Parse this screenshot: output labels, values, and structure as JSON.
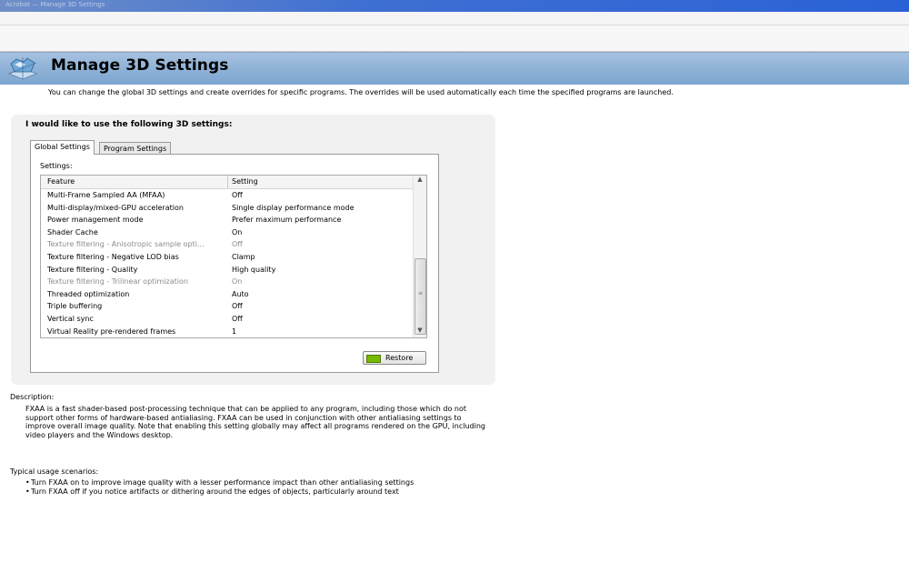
{
  "window": {
    "title_bar_text": "Acrobat — Manage 3D Settings"
  },
  "header": {
    "title": "Manage 3D Settings",
    "icon": "nvidia-3d-settings-icon"
  },
  "intro_text": "You can change the global 3D settings and create overrides for specific programs. The overrides will be used automatically each time the specified programs are launched.",
  "panel": {
    "heading": "I would like to use the following 3D settings:",
    "tabs": [
      {
        "label": "Global Settings",
        "active": true
      },
      {
        "label": "Program Settings",
        "active": false
      }
    ],
    "settings_label": "Settings:",
    "columns": {
      "feature": "Feature",
      "setting": "Setting"
    },
    "rows": [
      {
        "feature": "Multi-Frame Sampled AA (MFAA)",
        "setting": "Off",
        "disabled": false
      },
      {
        "feature": "Multi-display/mixed-GPU acceleration",
        "setting": "Single display performance mode",
        "disabled": false
      },
      {
        "feature": "Power management mode",
        "setting": "Prefer maximum performance",
        "disabled": false
      },
      {
        "feature": "Shader Cache",
        "setting": "On",
        "disabled": false
      },
      {
        "feature": "Texture filtering - Anisotropic sample opti...",
        "setting": "Off",
        "disabled": true
      },
      {
        "feature": "Texture filtering - Negative LOD bias",
        "setting": "Clamp",
        "disabled": false
      },
      {
        "feature": "Texture filtering - Quality",
        "setting": "High quality",
        "disabled": false
      },
      {
        "feature": "Texture filtering - Trilinear optimization",
        "setting": "On",
        "disabled": true
      },
      {
        "feature": "Threaded optimization",
        "setting": "Auto",
        "disabled": false
      },
      {
        "feature": "Triple buffering",
        "setting": "Off",
        "disabled": false
      },
      {
        "feature": "Vertical sync",
        "setting": "Off",
        "disabled": false
      },
      {
        "feature": "Virtual Reality pre-rendered frames",
        "setting": "1",
        "disabled": false
      }
    ],
    "restore_label": "Restore"
  },
  "description": {
    "title": "Description:",
    "text": "FXAA is a fast shader-based post-processing technique that can be applied to any program, including those which do not support other forms of hardware-based antialiasing. FXAA can be used in conjunction with other antialiasing settings to improve overall image quality. Note that enabling this setting globally may affect all programs rendered on the GPU, including video players and the Windows desktop."
  },
  "usage": {
    "title": "Typical usage scenarios:",
    "items": [
      "Turn FXAA on to improve image quality with a lesser performance impact than other antialiasing settings",
      "Turn FXAA off if you notice artifacts or dithering around the edges of objects, particularly around text"
    ]
  },
  "colors": {
    "header_blue": "#8fb2d7",
    "nvidia_green": "#76b900",
    "disabled_text": "#8c8c8c"
  }
}
